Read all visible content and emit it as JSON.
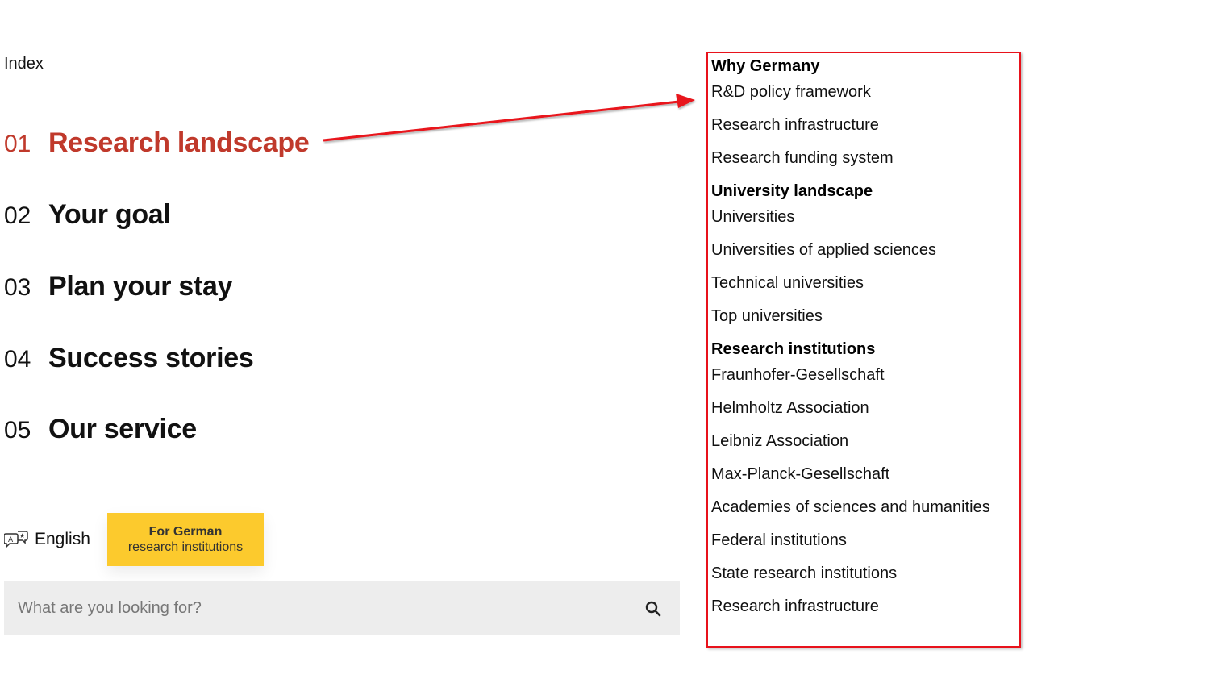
{
  "index_label": "Index",
  "nav": [
    {
      "num": "01",
      "label": "Research landscape",
      "active": true
    },
    {
      "num": "02",
      "label": "Your goal",
      "active": false
    },
    {
      "num": "03",
      "label": "Plan your stay",
      "active": false
    },
    {
      "num": "04",
      "label": "Success stories",
      "active": false
    },
    {
      "num": "05",
      "label": "Our service",
      "active": false
    }
  ],
  "language": {
    "icon": "translate-icon",
    "label": "English"
  },
  "cta": {
    "line1": "For German",
    "line2": "research institutions",
    "color": "#fcca2d"
  },
  "search": {
    "placeholder": "What are you looking for?",
    "value": "",
    "icon": "search-icon"
  },
  "accent_color": "#c0392b",
  "annotation": {
    "arrow_color": "#e8121b",
    "box_color": "#e8121b"
  },
  "submenu": [
    {
      "title": "Why Germany",
      "links": [
        "R&D policy framework",
        "Research infrastructure",
        "Research funding system"
      ]
    },
    {
      "title": "University landscape",
      "links": [
        "Universities",
        "Universities of applied sciences",
        "Technical universities",
        "Top universities"
      ]
    },
    {
      "title": "Research institutions",
      "links": [
        "Fraunhofer-Gesellschaft",
        "Helmholtz Association",
        "Leibniz Association",
        "Max-Planck-Gesellschaft",
        "Academies of sciences and humanities",
        "Federal institutions",
        "State research institutions",
        "Research infrastructure"
      ]
    }
  ]
}
